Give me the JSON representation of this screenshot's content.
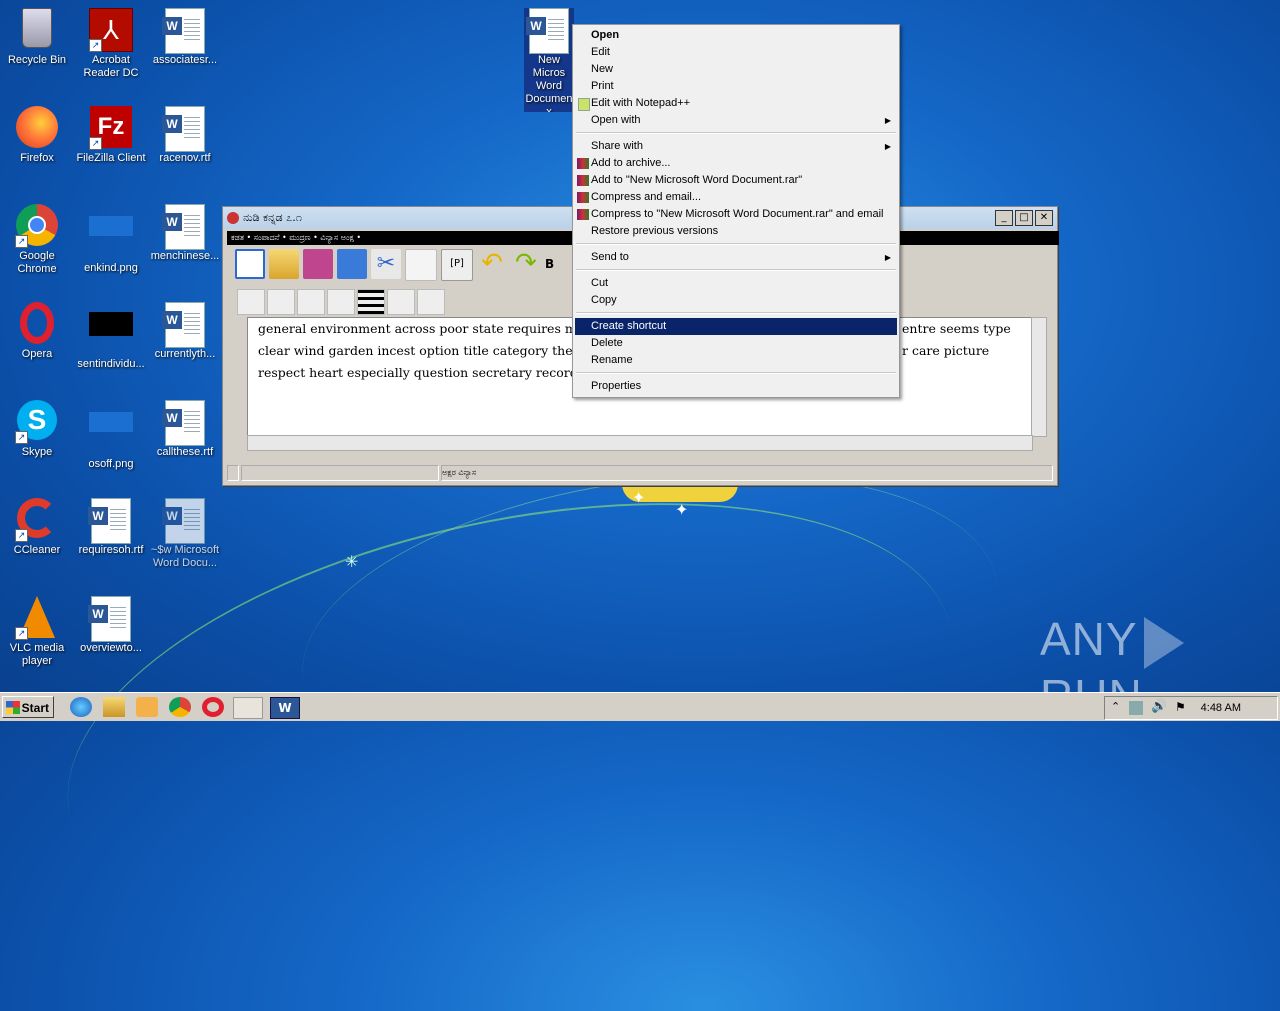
{
  "desktop": {
    "icons": [
      {
        "label": "Recycle Bin"
      },
      {
        "label": "Acrobat\nReader DC"
      },
      {
        "label": "associatesr..."
      },
      {
        "label": "Firefox"
      },
      {
        "label": "FileZilla Client"
      },
      {
        "label": "racenov.rtf"
      },
      {
        "label": "Google\nChrome"
      },
      {
        "label": "enkind.png"
      },
      {
        "label": "menchinese..."
      },
      {
        "label": "Opera"
      },
      {
        "label": "sentindividu..."
      },
      {
        "label": "currentlyth..."
      },
      {
        "label": "Skype"
      },
      {
        "label": "osoff.png"
      },
      {
        "label": "callthese.rtf"
      },
      {
        "label": "CCleaner"
      },
      {
        "label": "requiresoh.rtf"
      },
      {
        "label": "~$w Microsoft\nWord Docu..."
      },
      {
        "label": "VLC media\nplayer"
      },
      {
        "label": "overviewto..."
      }
    ],
    "selected_icon_label": "New Micros\nWord\nDocumen\nx",
    "watermark": "ANY RUN"
  },
  "app_window": {
    "title": "ನುಡಿ ಕನ್ನಡ ೭.೧",
    "menu": "ಕಡತ • ಸಂಪಾದನೆ • ಮುದ್ರಣ • ವಿನ್ಯಾಸ ಅಂಕ್ಷ •",
    "editor_lines": [
      "general  environment  across poor  state  requires  m",
      "clear wind garden  incest option title category theory",
      "respect heart especially question secretary record pr"
    ],
    "editor_right_fragments": [
      "entre seems  type",
      "r care picture"
    ],
    "status_text": "ಅಕ್ಷರ ವಿನ್ಯಾಸ",
    "toolbar_p_label": "[P]",
    "toolbar_b_label": "B"
  },
  "context_menu": {
    "items": [
      {
        "label": "Open",
        "bold": true
      },
      {
        "label": "Edit"
      },
      {
        "label": "New"
      },
      {
        "label": "Print"
      },
      {
        "label": "Edit with Notepad++"
      },
      {
        "label": "Open with"
      },
      {
        "label": "Share with"
      },
      {
        "label": "Add to archive..."
      },
      {
        "label": "Add to \"New Microsoft Word Document.rar\""
      },
      {
        "label": "Compress and email..."
      },
      {
        "label": "Compress to \"New Microsoft Word Document.rar\" and email"
      },
      {
        "label": "Restore previous versions"
      },
      {
        "label": "Send to"
      },
      {
        "label": "Cut"
      },
      {
        "label": "Copy"
      },
      {
        "label": "Create shortcut",
        "selected": true
      },
      {
        "label": "Delete"
      },
      {
        "label": "Rename"
      },
      {
        "label": "Properties"
      }
    ]
  },
  "taskbar": {
    "start_label": "Start",
    "clock": "4:48 AM"
  },
  "colors": {
    "menu_highlight": "#0a246a",
    "desktop_blue": "#1568c8"
  }
}
